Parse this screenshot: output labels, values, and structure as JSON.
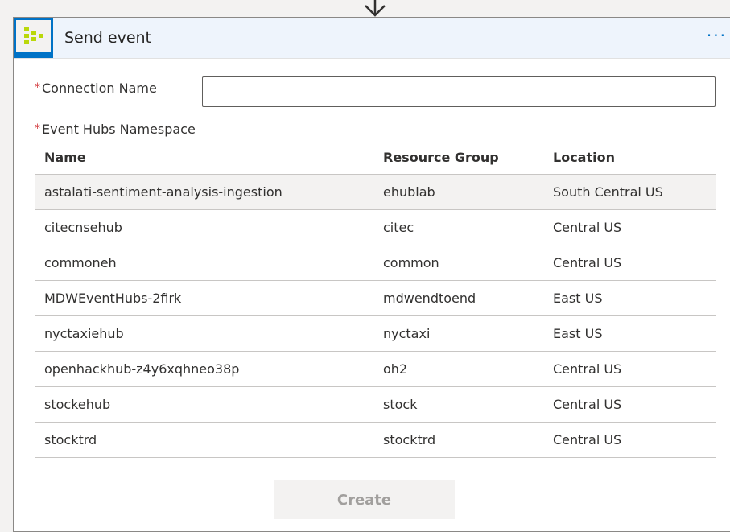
{
  "action": {
    "title": "Send event",
    "more_label": "···"
  },
  "form": {
    "required_marker": "*",
    "connection_name_label": "Connection Name",
    "connection_name_value": "",
    "namespace_label": "Event Hubs Namespace"
  },
  "table": {
    "columns": [
      "Name",
      "Resource Group",
      "Location"
    ],
    "rows": [
      {
        "name": "astalati-sentiment-analysis-ingestion",
        "resource_group": "ehublab",
        "location": "South Central US",
        "selected": true
      },
      {
        "name": "citecnsehub",
        "resource_group": "citec",
        "location": "Central US"
      },
      {
        "name": "commoneh",
        "resource_group": "common",
        "location": "Central US"
      },
      {
        "name": "MDWEventHubs-2firk",
        "resource_group": "mdwendtoend",
        "location": "East US"
      },
      {
        "name": "nyctaxiehub",
        "resource_group": "nyctaxi",
        "location": "East US"
      },
      {
        "name": "openhackhub-z4y6xqhneo38p",
        "resource_group": "oh2",
        "location": "Central US"
      },
      {
        "name": "stockehub",
        "resource_group": "stock",
        "location": "Central US"
      },
      {
        "name": "stocktrd",
        "resource_group": "stocktrd",
        "location": "Central US"
      }
    ]
  },
  "buttons": {
    "create_label": "Create"
  },
  "icons": {
    "connector_arrow": "arrow-down-icon",
    "action_icon": "event-hubs-icon",
    "more": "more-icon"
  },
  "colors": {
    "accent": "#0072c6",
    "header_bg": "#eef4fc",
    "required": "#d13438",
    "event_hubs_green": "#bad80a"
  }
}
